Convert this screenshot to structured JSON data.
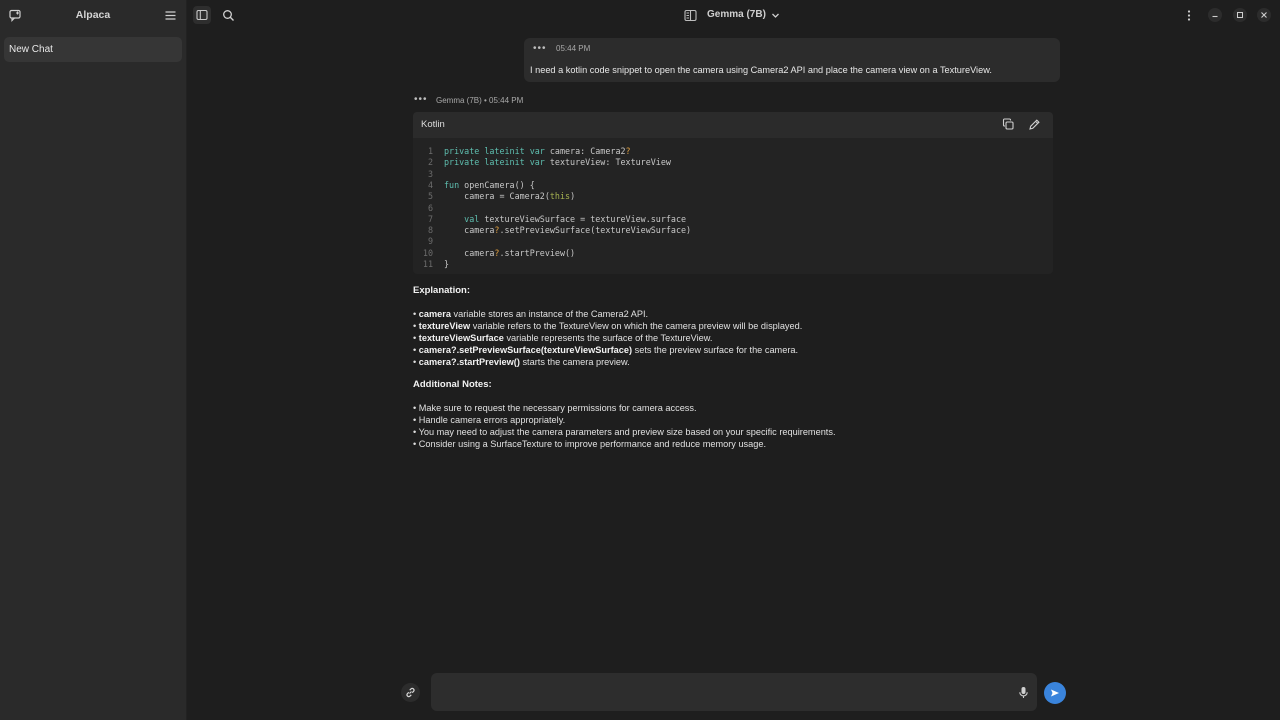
{
  "sidebar": {
    "title": "Alpaca",
    "new_chat_icon": "new-chat-icon",
    "menu_icon": "hamburger-menu-icon",
    "chats": [
      {
        "label": "New Chat",
        "selected": true
      }
    ]
  },
  "header": {
    "model_name": "Gemma (7B)",
    "model_icon": "model-manager-icon",
    "chevron_icon": "chevron-down-icon",
    "toggle_icon": "sidebar-toggle-icon",
    "search_icon": "search-icon",
    "window_icons": [
      "more-vertical-icon",
      "minimize-icon",
      "maximize-icon",
      "close-icon"
    ]
  },
  "user_message": {
    "dots": "•••",
    "time": "05:44 PM",
    "text": "I need a kotlin code snippet to open the camera using Camera2 API and place the camera view on a TextureView."
  },
  "bot_message": {
    "dots": "•••",
    "meta": "Gemma (7B) • 05:44 PM",
    "code": {
      "language": "Kotlin",
      "copy_icon": "copy-icon",
      "edit_icon": "edit-pencil-icon",
      "lines": [
        {
          "n": "1",
          "tokens": [
            [
              "kw",
              "private lateinit var "
            ],
            [
              "txt",
              "camera: Camera2"
            ],
            [
              "op",
              "?"
            ]
          ]
        },
        {
          "n": "2",
          "tokens": [
            [
              "kw",
              "private lateinit var "
            ],
            [
              "txt",
              "textureView: TextureView"
            ]
          ]
        },
        {
          "n": "3",
          "tokens": []
        },
        {
          "n": "4",
          "tokens": [
            [
              "kw",
              "fun "
            ],
            [
              "txt",
              "openCamera() {"
            ]
          ]
        },
        {
          "n": "5",
          "tokens": [
            [
              "txt",
              "    camera = Camera2("
            ],
            [
              "lit",
              "this"
            ],
            [
              "txt",
              ")"
            ]
          ]
        },
        {
          "n": "6",
          "tokens": []
        },
        {
          "n": "7",
          "tokens": [
            [
              "kw",
              "    val "
            ],
            [
              "txt",
              "textureViewSurface = textureView.surface"
            ]
          ]
        },
        {
          "n": "8",
          "tokens": [
            [
              "txt",
              "    camera"
            ],
            [
              "op",
              "?"
            ],
            [
              "txt",
              ".setPreviewSurface(textureViewSurface)"
            ]
          ]
        },
        {
          "n": "9",
          "tokens": []
        },
        {
          "n": "10",
          "tokens": [
            [
              "txt",
              "    camera"
            ],
            [
              "op",
              "?"
            ],
            [
              "txt",
              ".startPreview()"
            ]
          ]
        },
        {
          "n": "11",
          "tokens": [
            [
              "txt",
              "}"
            ]
          ]
        }
      ]
    },
    "explanation": {
      "heading": "Explanation:",
      "items": [
        {
          "bold": "camera",
          "rest": " variable stores an instance of the Camera2 API."
        },
        {
          "bold": "textureView",
          "rest": " variable refers to the TextureView on which the camera preview will be displayed."
        },
        {
          "bold": "textureViewSurface",
          "rest": " variable represents the surface of the TextureView."
        },
        {
          "bold": "camera?.setPreviewSurface(textureViewSurface)",
          "rest": " sets the preview surface for the camera."
        },
        {
          "bold": "camera?.startPreview()",
          "rest": " starts the camera preview."
        }
      ]
    },
    "notes": {
      "heading": "Additional Notes:",
      "items": [
        "Make sure to request the necessary permissions for camera access.",
        "Handle camera errors appropriately.",
        "You may need to adjust the camera parameters and preview size based on your specific requirements.",
        "Consider using a SurfaceTexture to improve performance and reduce memory usage."
      ]
    }
  },
  "input": {
    "value": "",
    "placeholder": "",
    "attach_icon": "attachment-icon",
    "mic_icon": "microphone-icon",
    "send_icon": "send-icon"
  },
  "colors": {
    "background": "#1e1e1e",
    "sidebar": "#2a2a2a",
    "accent": "#3a84dc",
    "keyword": "#5fbfb0",
    "operator": "#e0a040",
    "literal": "#a4b050"
  }
}
